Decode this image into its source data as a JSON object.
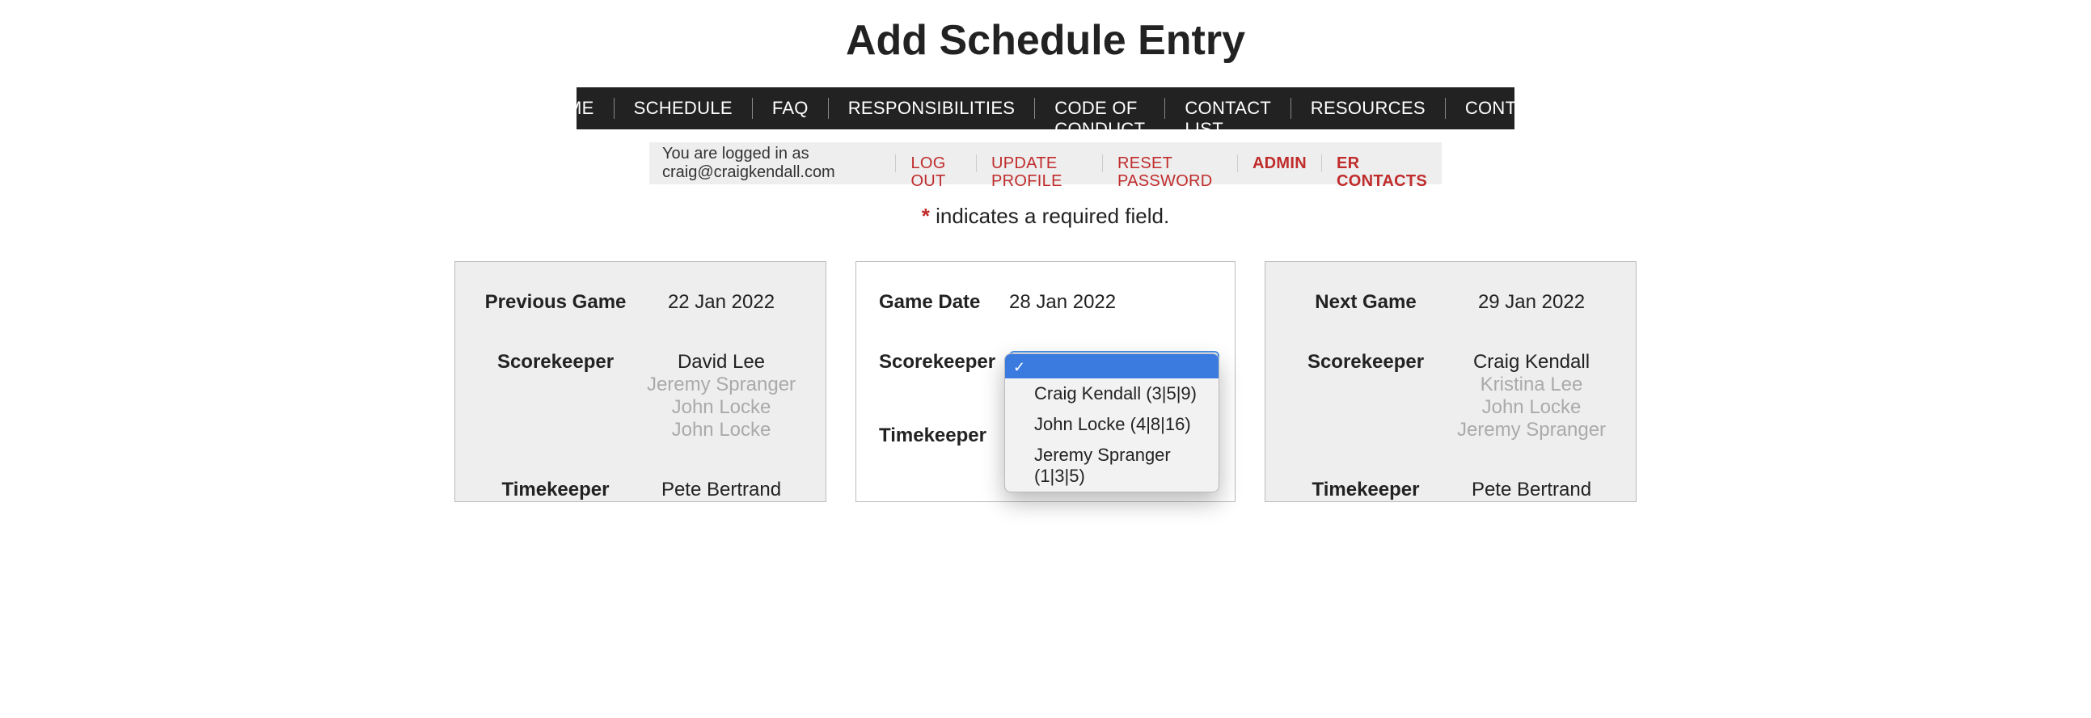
{
  "page_title": "Add Schedule Entry",
  "nav": {
    "items": [
      "HOME",
      "SCHEDULE",
      "FAQ",
      "RESPONSIBILITIES",
      "CODE OF CONDUCT",
      "CONTACT LIST",
      "RESOURCES",
      "CONTACT"
    ]
  },
  "subnav": {
    "login_text": "You are logged in as craig@craigkendall.com",
    "logout": "LOG OUT",
    "update_profile": "UPDATE PROFILE",
    "reset_password": "RESET PASSWORD",
    "admin": "ADMIN",
    "er_contacts": "ER CONTACTS"
  },
  "required_note": "indicates a required field.",
  "previous_game": {
    "title": "Previous Game",
    "date": "22 Jan 2022",
    "scorekeeper_label": "Scorekeeper",
    "scorekeeper_primary": "David Lee",
    "scorekeeper_others": [
      "Jeremy Spranger",
      "John Locke",
      "John Locke"
    ],
    "timekeeper_label": "Timekeeper",
    "timekeeper_primary": "Pete Bertrand"
  },
  "current_game": {
    "game_date_label": "Game Date",
    "game_date": "28 Jan 2022",
    "scorekeeper_label": "Scorekeeper",
    "timekeeper_label": "Timekeeper",
    "dropdown_options": [
      "",
      "Craig Kendall (3|5|9)",
      "John Locke (4|8|16)",
      "Jeremy Spranger (1|3|5)"
    ]
  },
  "next_game": {
    "title": "Next Game",
    "date": "29 Jan 2022",
    "scorekeeper_label": "Scorekeeper",
    "scorekeeper_primary": "Craig Kendall",
    "scorekeeper_others": [
      "Kristina Lee",
      "John Locke",
      "Jeremy Spranger"
    ],
    "timekeeper_label": "Timekeeper",
    "timekeeper_primary": "Pete Bertrand"
  }
}
